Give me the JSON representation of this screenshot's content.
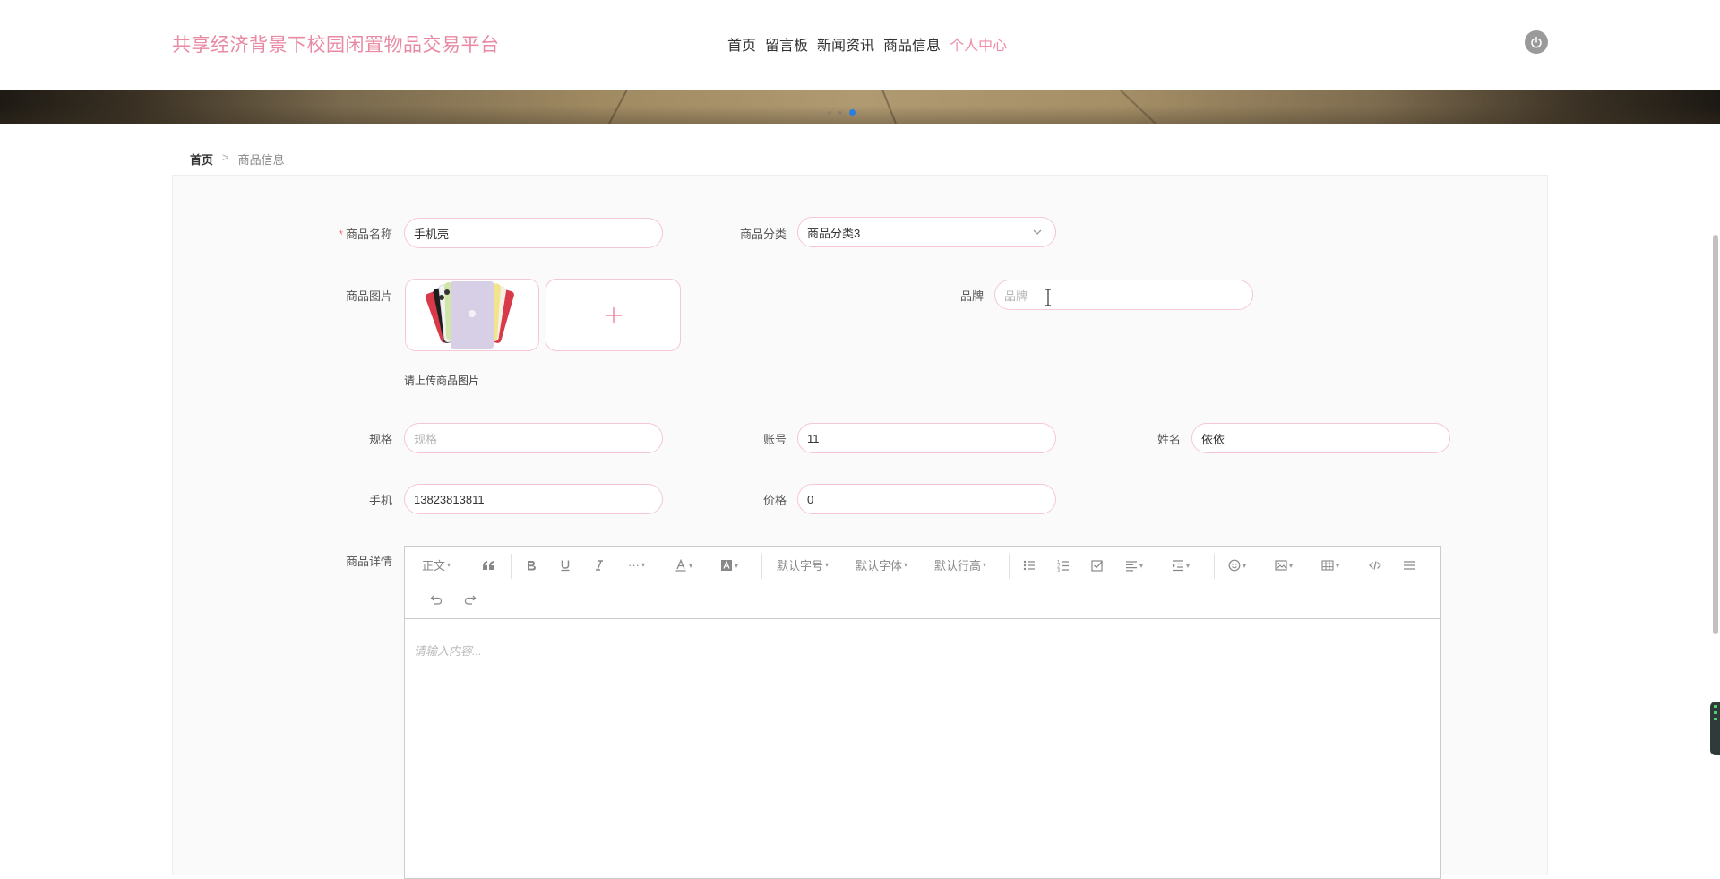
{
  "header": {
    "site_title": "共享经济背景下校园闲置物品交易平台",
    "nav": [
      {
        "label": "首页",
        "active": false
      },
      {
        "label": "留言板",
        "active": false
      },
      {
        "label": "新闻资讯",
        "active": false
      },
      {
        "label": "商品信息",
        "active": false
      },
      {
        "label": "个人中心",
        "active": true
      }
    ],
    "power_icon": "power-icon"
  },
  "carousel": {
    "dots": 3,
    "active_index": 2
  },
  "breadcrumb": {
    "home": "首页",
    "separator": ">",
    "current": "商品信息"
  },
  "form": {
    "name": {
      "label": "商品名称",
      "required_mark": "*",
      "value": "手机壳"
    },
    "category": {
      "label": "商品分类",
      "value": "商品分类3"
    },
    "image": {
      "label": "商品图片",
      "tip": "请上传商品图片",
      "add_icon": "plus-icon"
    },
    "brand": {
      "label": "品牌",
      "placeholder": "品牌"
    },
    "spec": {
      "label": "规格",
      "placeholder": "规格"
    },
    "account": {
      "label": "账号",
      "value": "11"
    },
    "realname": {
      "label": "姓名",
      "value": "依依"
    },
    "phone": {
      "label": "手机",
      "value": "13823813811"
    },
    "price": {
      "label": "价格",
      "value": "0"
    },
    "detail": {
      "label": "商品详情",
      "placeholder": "请输入内容...",
      "toolbar": {
        "heading": "正文",
        "font_size": "默认字号",
        "font_family": "默认字体",
        "line_height": "默认行高"
      }
    }
  },
  "colors": {
    "brand": "#e88aa3",
    "active_nav": "#f08ba8",
    "input_border": "#f5c7d4",
    "required": "#f56c6c"
  }
}
